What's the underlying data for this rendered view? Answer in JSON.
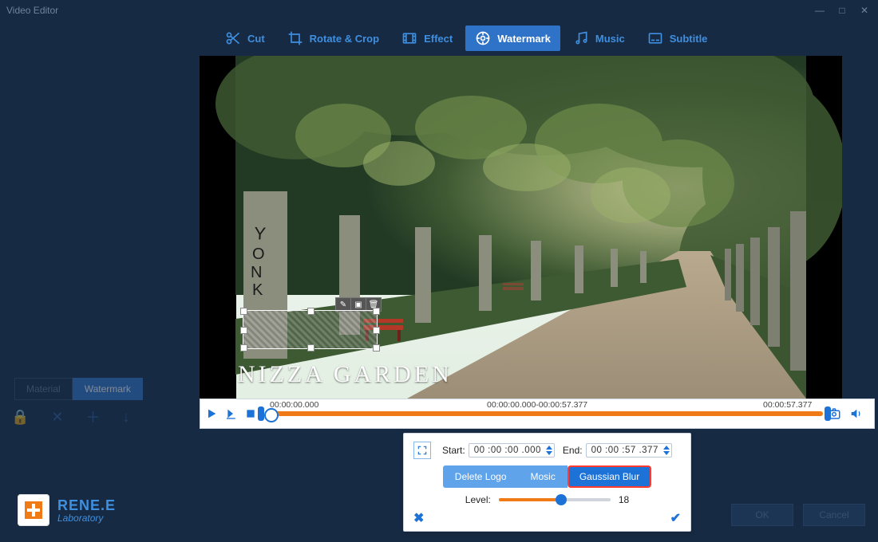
{
  "window": {
    "title": "Video Editor"
  },
  "toolbar": {
    "cut": "Cut",
    "rotate": "Rotate & Crop",
    "effect": "Effect",
    "watermark": "Watermark",
    "music": "Music",
    "subtitle": "Subtitle",
    "active": "watermark"
  },
  "left_tabs": {
    "material": "Material",
    "watermark": "Watermark"
  },
  "preview": {
    "caption_text": "NIZZA GARDEN"
  },
  "timeline": {
    "start_label": "00:00:00.000",
    "range_label": "00:00:00.000-00:00:57.377",
    "end_label": "00:00:57.377"
  },
  "popup": {
    "start_label": "Start:",
    "start_value": "00 :00 :00 .000",
    "end_label": "End:",
    "end_value": "00 :00 :57 .377",
    "buttons": {
      "delete_logo": "Delete Logo",
      "mosic": "Mosic",
      "gaussian": "Gaussian Blur"
    },
    "level_label": "Level:",
    "level_value": "18"
  },
  "logo": {
    "line1": "RENE.E",
    "line2": "Laboratory"
  },
  "footer": {
    "ok": "OK",
    "cancel": "Cancel"
  }
}
